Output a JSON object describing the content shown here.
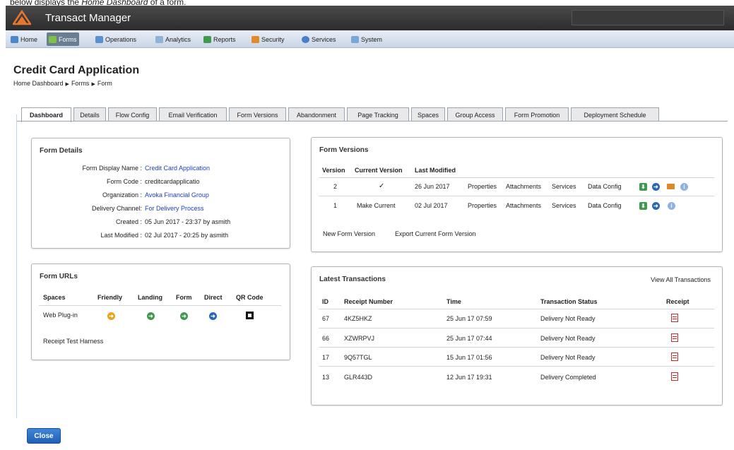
{
  "caption": {
    "before": "below displays the ",
    "emph": "Home Dashboard",
    "after": " of a form."
  },
  "app": {
    "title": "Transact Manager"
  },
  "nav": [
    {
      "label": "Home",
      "icon": "home-icon"
    },
    {
      "label": "Forms",
      "icon": "forms-icon",
      "active": true
    },
    {
      "label": "Operations",
      "icon": "operations-icon"
    },
    {
      "label": "Analytics",
      "icon": "analytics-icon"
    },
    {
      "label": "Reports",
      "icon": "reports-icon"
    },
    {
      "label": "Security",
      "icon": "security-icon"
    },
    {
      "label": "Services",
      "icon": "services-icon"
    },
    {
      "label": "System",
      "icon": "system-icon"
    }
  ],
  "page": {
    "title": "Credit Card Application"
  },
  "breadcrumb": [
    "Home Dashboard",
    "Forms",
    "Form"
  ],
  "tabs": [
    "Dashboard",
    "Details",
    "Flow Config",
    "Email Verification",
    "Form Versions",
    "Abandonment",
    "Page Tracking",
    "Spaces",
    "Group Access",
    "Form Promotion",
    "Deployment Schedule"
  ],
  "form_details": {
    "title": "Form Details",
    "rows": [
      {
        "label": "Form Display Name :",
        "value": "Credit Card Application",
        "link": true
      },
      {
        "label": "Form Code :",
        "value": "creditcardapplicatio",
        "link": false
      },
      {
        "label": "Organization :",
        "value": "Avoka Financial Group",
        "link": true
      },
      {
        "label": "Delivery Channel:",
        "value": "For Delivery Process",
        "link": true
      },
      {
        "label": "Created :",
        "value": "05 Jun 2017 - 23:37 by asmith",
        "link": false
      },
      {
        "label": "Last Modified :",
        "value": "02 Jul 2017 - 20:25 by asmith",
        "link": false
      }
    ]
  },
  "form_urls": {
    "title": "Form URLs",
    "headers": [
      "Spaces",
      "Friendly",
      "Landing",
      "Form",
      "Direct",
      "QR Code"
    ],
    "rows": [
      {
        "space": "Web Plug-in"
      }
    ],
    "footer_link": "Receipt Test Harness"
  },
  "form_versions": {
    "title": "Form Versions",
    "headers": [
      "Version",
      "Current Version",
      "Last Modified"
    ],
    "rows": [
      {
        "version": "2",
        "current": "✓",
        "modified": "26 Jun 2017",
        "actions": [
          "Properties",
          "Attachments",
          "Services",
          "Data Config"
        ]
      },
      {
        "version": "1",
        "current": "Make Current",
        "modified": "02 Jul 2017",
        "actions": [
          "Properties",
          "Attachments",
          "Services",
          "Data Config"
        ]
      }
    ],
    "links": [
      "New Form Version",
      "Export Current Form Version"
    ]
  },
  "transactions": {
    "title": "Latest Transactions",
    "view_all": "View All Transactions",
    "headers": [
      "ID",
      "Receipt Number",
      "Time",
      "Transaction Status",
      "Receipt"
    ],
    "rows": [
      {
        "id": "67",
        "receipt": "4KZ5HKZ",
        "time": "25 Jun 17 07:59",
        "status": "Delivery Not Ready",
        "ready": false
      },
      {
        "id": "66",
        "receipt": "XZWRPVJ",
        "time": "25 Jun 17 07:44",
        "status": "Delivery Not Ready",
        "ready": false
      },
      {
        "id": "17",
        "receipt": "9Q57TGL",
        "time": "15 Jun 17 01:56",
        "status": "Delivery Not Ready",
        "ready": false
      },
      {
        "id": "13",
        "receipt": "GLR443D",
        "time": "12 Jun 17 19:31",
        "status": "Delivery Completed",
        "ready": true
      }
    ]
  },
  "close_label": "Close",
  "colors": {
    "link": "#1e3fc4",
    "status_green": "#237d2e",
    "primary_button": "#2a6fc9",
    "topbar": "#3a3a3a"
  }
}
